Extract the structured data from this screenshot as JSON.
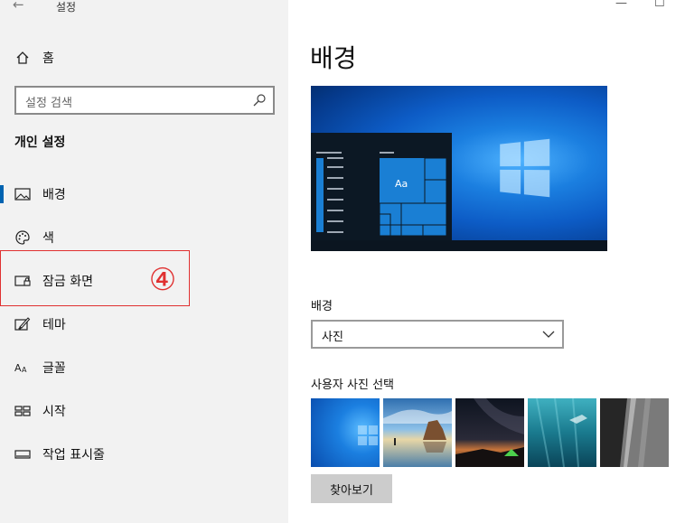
{
  "app": {
    "title": "설정"
  },
  "window_controls": {
    "minimize": "—",
    "maximize": "☐"
  },
  "sidebar": {
    "home_label": "홈",
    "search_placeholder": "설정 검색",
    "section_title": "개인 설정",
    "items": [
      {
        "label": "배경",
        "icon": "picture-icon",
        "selected": true
      },
      {
        "label": "색",
        "icon": "palette-icon",
        "selected": false
      },
      {
        "label": "잠금 화면",
        "icon": "lock-screen-icon",
        "selected": false
      },
      {
        "label": "테마",
        "icon": "theme-brush-icon",
        "selected": false
      },
      {
        "label": "글꼴",
        "icon": "font-icon",
        "selected": false
      },
      {
        "label": "시작",
        "icon": "start-grid-icon",
        "selected": false
      },
      {
        "label": "작업 표시줄",
        "icon": "taskbar-icon",
        "selected": false
      }
    ]
  },
  "annotation": {
    "step_number": "④",
    "color": "#e03030"
  },
  "main": {
    "title": "배경",
    "preview_tile_text": "Aa",
    "background_label": "배경",
    "background_value": "사진",
    "choose_label": "사용자 사진 선택",
    "browse_button": "찾아보기"
  },
  "colors": {
    "accent": "#0063b1",
    "sidebar_bg": "#f2f2f2",
    "tile_blue": "#1a7fd4"
  }
}
